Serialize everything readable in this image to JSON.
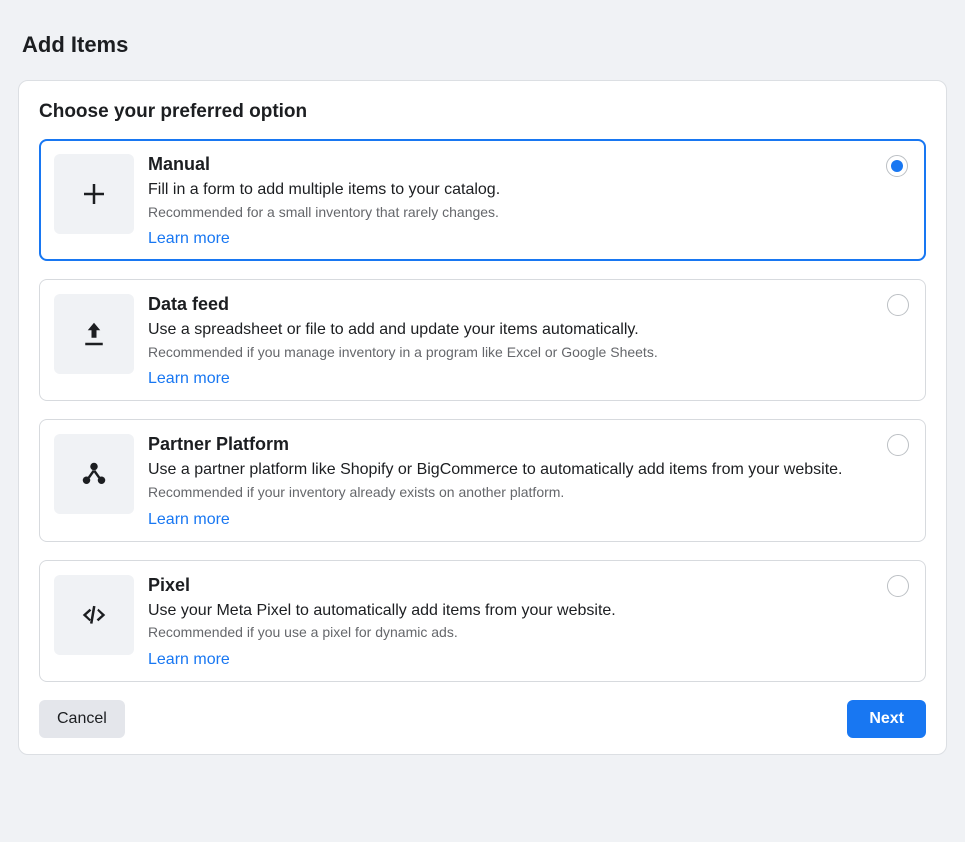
{
  "page": {
    "title": "Add Items"
  },
  "card": {
    "title": "Choose your preferred option"
  },
  "options": [
    {
      "title": "Manual",
      "description": "Fill in a form to add multiple items to your catalog.",
      "recommendation": "Recommended for a small inventory that rarely changes.",
      "link_label": "Learn more",
      "selected": true
    },
    {
      "title": "Data feed",
      "description": "Use a spreadsheet or file to add and update your items automatically.",
      "recommendation": "Recommended if you manage inventory in a program like Excel or Google Sheets.",
      "link_label": "Learn more",
      "selected": false
    },
    {
      "title": "Partner Platform",
      "description": "Use a partner platform like Shopify or BigCommerce to automatically add items from your website.",
      "recommendation": "Recommended if your inventory already exists on another platform.",
      "link_label": "Learn more",
      "selected": false
    },
    {
      "title": "Pixel",
      "description": "Use your Meta Pixel to automatically add items from your website.",
      "recommendation": "Recommended if you use a pixel for dynamic ads.",
      "link_label": "Learn more",
      "selected": false
    }
  ],
  "footer": {
    "cancel": "Cancel",
    "next": "Next"
  }
}
